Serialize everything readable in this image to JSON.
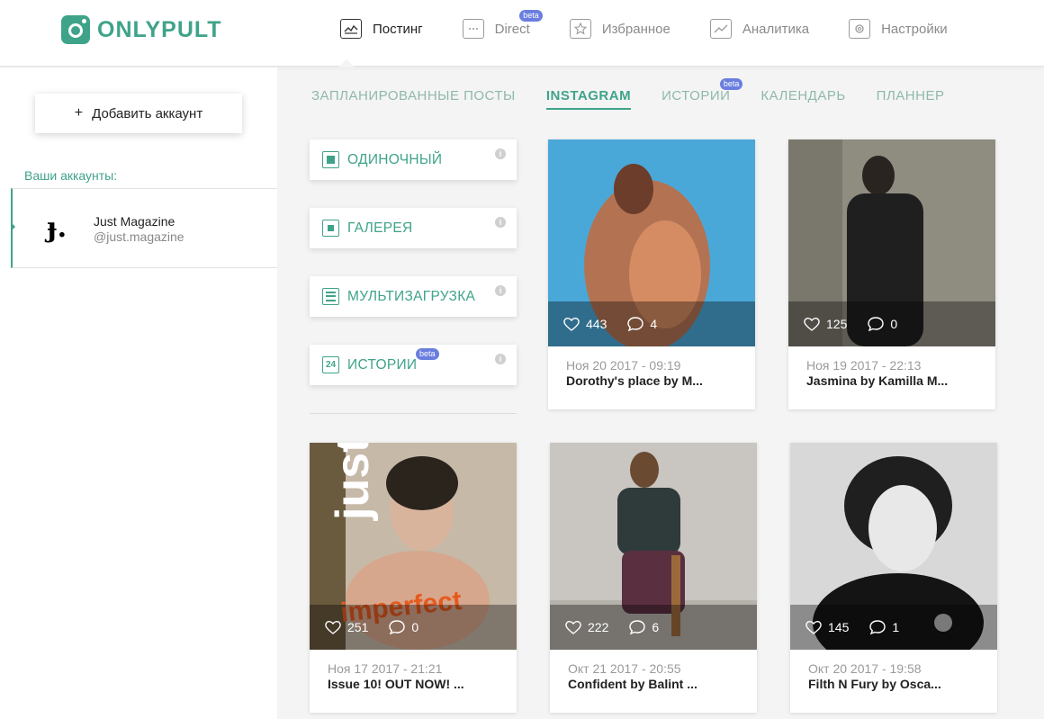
{
  "app": {
    "logo_text": "ONLYPULT",
    "accent_color": "#3fa38a",
    "badge_color": "#6a7ee0"
  },
  "nav": {
    "items": [
      {
        "label": "Постинг",
        "icon": "posting-icon",
        "active": true
      },
      {
        "label": "Direct",
        "icon": "direct-icon",
        "badge": "beta"
      },
      {
        "label": "Избранное",
        "icon": "star-icon"
      },
      {
        "label": "Аналитика",
        "icon": "analytics-icon"
      },
      {
        "label": "Настройки",
        "icon": "gear-icon"
      }
    ]
  },
  "sidebar": {
    "add_account_label": "Добавить аккаунт",
    "add_account_plus": "+",
    "accounts_title": "Ваши аккаунты:",
    "account": {
      "name": "Just Magazine",
      "handle": "@just.magazine",
      "avatar_glyph": "ɟ."
    }
  },
  "tabs": [
    {
      "label": "ЗАПЛАНИРОВАННЫЕ ПОСТЫ"
    },
    {
      "label": "INSTAGRAM",
      "active": true
    },
    {
      "label": "ИСТОРИИ",
      "badge": "beta"
    },
    {
      "label": "КАЛЕНДАРЬ"
    },
    {
      "label": "ПЛАННЕР"
    }
  ],
  "post_types": [
    {
      "label": "ОДИНОЧНЫЙ",
      "icon": "single-post-icon",
      "info": "i"
    },
    {
      "label": "ГАЛЕРЕЯ",
      "icon": "gallery-icon",
      "info": "i"
    },
    {
      "label": "МУЛЬТИЗАГРУЗКА",
      "icon": "multi-upload-icon",
      "info": "i"
    },
    {
      "label": "ИСТОРИИ",
      "icon": "stories-24-icon",
      "icon_text": "24",
      "badge": "beta",
      "info": "i"
    }
  ],
  "posts": [
    {
      "likes": "443",
      "comments": "4",
      "date": "Ноя 20 2017 - 09:19",
      "title": "Dorothy's place by M...",
      "bg": "#4aa8d8"
    },
    {
      "likes": "125",
      "comments": "0",
      "date": "Ноя 19 2017 - 22:13",
      "title": "Jasmina by Kamilla M...",
      "bg": "#8f8c80"
    },
    {
      "likes": "251",
      "comments": "0",
      "date": "Ноя 17 2017 - 21:21",
      "title": "Issue 10! OUT NOW! ...",
      "bg": "#c7b9a8",
      "overlay_text": "just",
      "overlay_text2": "imperfect"
    },
    {
      "likes": "222",
      "comments": "6",
      "date": "Окт 21 2017 - 20:55",
      "title": "Confident by Balint ...",
      "bg": "#c9c6c1"
    },
    {
      "likes": "145",
      "comments": "1",
      "date": "Окт 20 2017 - 19:58",
      "title": "Filth N Fury by Osca...",
      "bg": "#6e6e6e"
    }
  ]
}
